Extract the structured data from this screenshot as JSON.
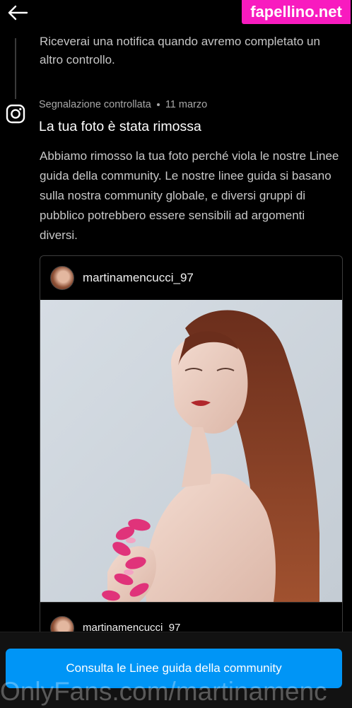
{
  "header": {
    "back_icon": "arrow-left-icon",
    "watermark_badge": "fapellino.net"
  },
  "previous_event": {
    "text": "Riceverai una notifica quando avremo completato un altro controllo."
  },
  "event": {
    "icon": "instagram-icon",
    "status": "Segnalazione controllata",
    "date": "11 marzo",
    "title": "La tua foto è stata rimossa",
    "body": "Abbiamo rimosso la tua foto perché viola le nostre Linee guida della community. Le nostre linee guida si basano sulla nostra community globale, e diversi gruppi di pubblico potrebbero essere sensibili ad argomenti diversi."
  },
  "post": {
    "username": "martinamencucci_97",
    "footer_username": "martinamencucci_97"
  },
  "cta": {
    "label": "Consulta le Linee guida della community"
  },
  "watermark_bottom": "OnlyFans.com/martinamenc",
  "colors": {
    "accent": "#0095f6",
    "badge": "#f81bbf",
    "background": "#000000"
  }
}
